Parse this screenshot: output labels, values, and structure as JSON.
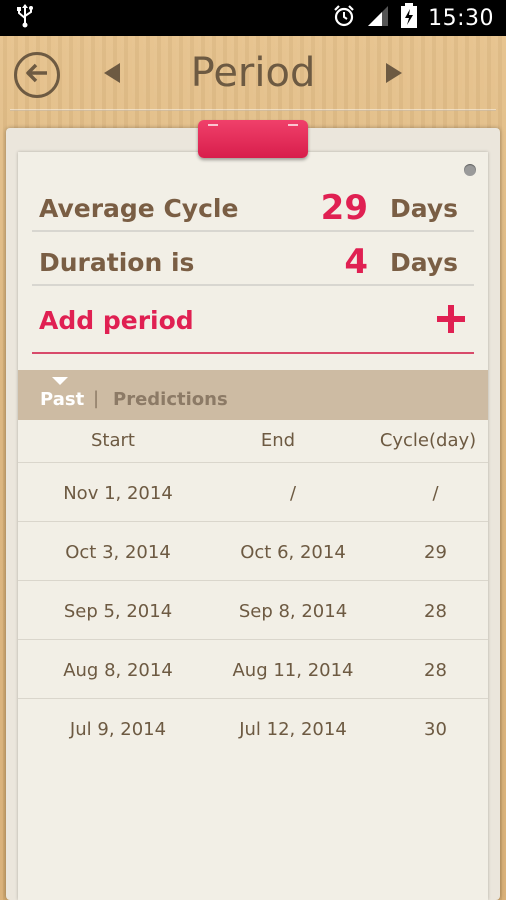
{
  "status_bar": {
    "time": "15:30",
    "icons": [
      "usb-icon",
      "alarm-icon",
      "signal-icon",
      "battery-charging-icon"
    ]
  },
  "header": {
    "title": "Period",
    "back_icon": "arrow-left-circle-icon",
    "prev_icon": "triangle-left-icon",
    "next_icon": "triangle-right-icon"
  },
  "summary": {
    "average_cycle": {
      "label": "Average Cycle",
      "value": "29",
      "unit": "Days"
    },
    "duration": {
      "label": "Duration is",
      "value": "4",
      "unit": "Days"
    },
    "add_period": {
      "label": "Add period",
      "icon": "plus-icon"
    }
  },
  "tabs": {
    "past": "Past",
    "separator": "|",
    "predictions": "Predictions",
    "active": "Past"
  },
  "table": {
    "headers": [
      "Start",
      "End",
      "Cycle(day)"
    ],
    "rows": [
      {
        "start": "Nov 1, 2014",
        "end": "/",
        "cycle": "/"
      },
      {
        "start": "Oct 3, 2014",
        "end": "Oct 6, 2014",
        "cycle": "29"
      },
      {
        "start": "Sep 5, 2014",
        "end": "Sep 8, 2014",
        "cycle": "28"
      },
      {
        "start": "Aug 8, 2014",
        "end": "Aug 11, 2014",
        "cycle": "28"
      },
      {
        "start": "Jul 9, 2014",
        "end": "Jul 12, 2014",
        "cycle": "30"
      }
    ]
  },
  "colors": {
    "accent": "#e02052",
    "text_brown": "#7a5e44",
    "wood": "#dbb47c",
    "paper": "#f2efe6",
    "tab_bar": "#cdbba3"
  }
}
